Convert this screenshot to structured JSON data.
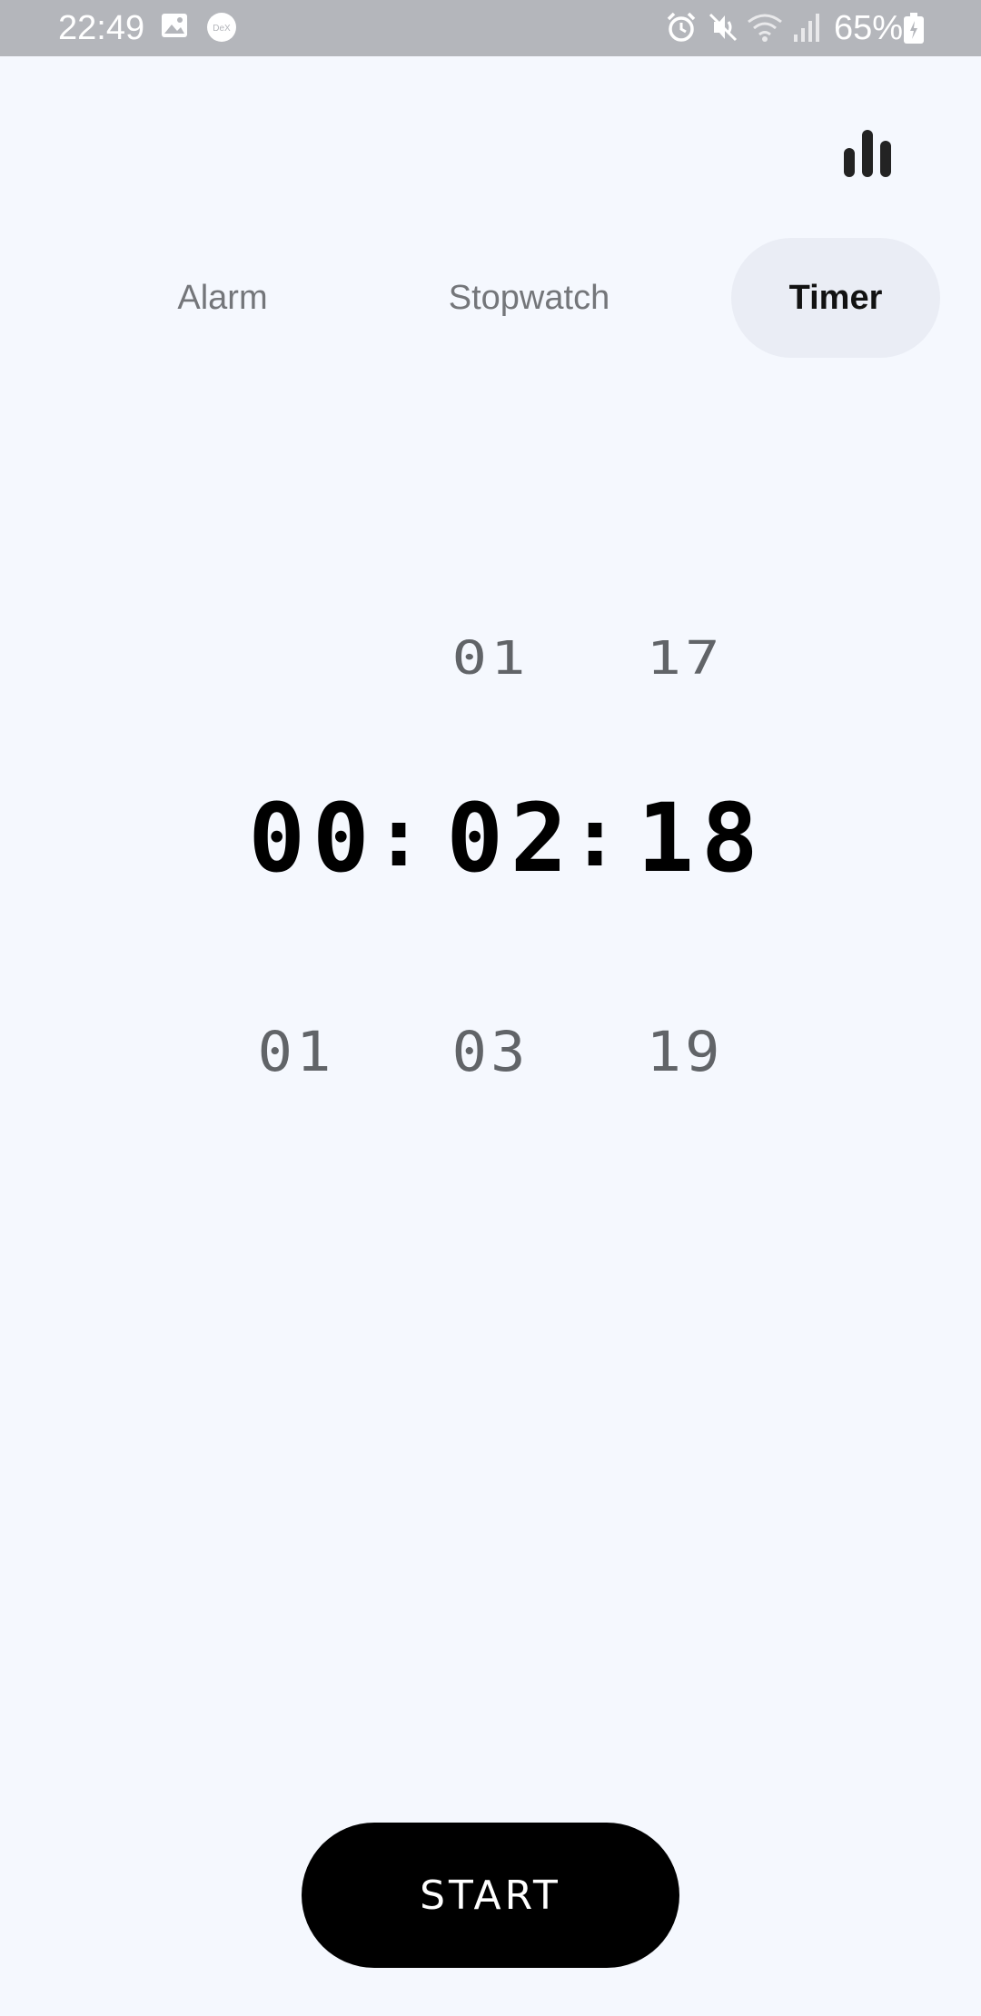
{
  "status_bar": {
    "time": "22:49",
    "battery": "65%",
    "icons": [
      "gallery-icon",
      "dex-icon",
      "alarm-icon",
      "mute-icon",
      "wifi-icon",
      "signal-icon",
      "battery-icon"
    ]
  },
  "toolbar": {
    "stats_icon": "bar-chart-icon"
  },
  "tabs": [
    {
      "label": "Alarm",
      "selected": false
    },
    {
      "label": "Stopwatch",
      "selected": false
    },
    {
      "label": "Timer",
      "selected": true
    }
  ],
  "timer": {
    "previous": {
      "hours": "",
      "minutes": "01",
      "seconds": "17"
    },
    "current": {
      "hours": "00",
      "minutes": "02",
      "seconds": "18"
    },
    "next": {
      "hours": "01",
      "minutes": "03",
      "seconds": "19"
    },
    "separator": ":"
  },
  "actions": {
    "start_label": "START"
  },
  "colors": {
    "background": "#f5f8fe",
    "status_bar": "#b4b6bb",
    "selected_tab_bg": "#eaedf5",
    "button_bg": "#000000"
  }
}
